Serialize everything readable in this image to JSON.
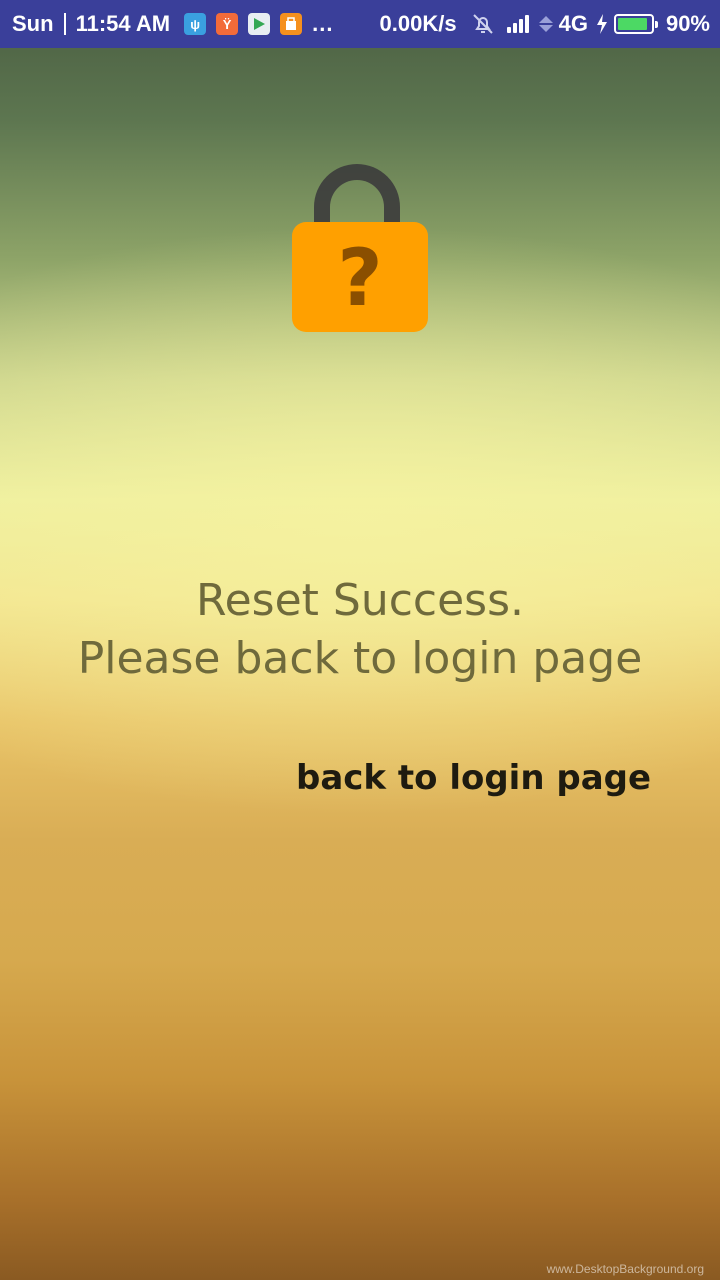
{
  "status_bar": {
    "day": "Sun",
    "time": "11:54 AM",
    "dots": "...",
    "net_speed": "0.00K/s",
    "network_type": "4G",
    "battery_percent": "90%",
    "battery_level": 0.9,
    "icons": [
      "usb-icon",
      "mi-app-icon",
      "play-store-icon",
      "shop-app-icon",
      "bell-muted-icon",
      "signal-icon",
      "data-arrows-icon",
      "charging-bolt-icon",
      "battery-icon"
    ]
  },
  "main": {
    "lock_icon": "lock-question-icon",
    "lock_symbol": "?",
    "message_line1": "Reset Success.",
    "message_line2": "Please back to login page",
    "back_link_label": "back to login page"
  },
  "watermark": "www.DesktopBackground.org",
  "colors": {
    "status_bar_bg": "#3a3f9a",
    "lock_body": "#ffa000",
    "lock_shackle": "#3c3c3c",
    "message_text": "#6f6a3c",
    "link_text": "#1e1b10",
    "battery_fill": "#4cd964"
  }
}
